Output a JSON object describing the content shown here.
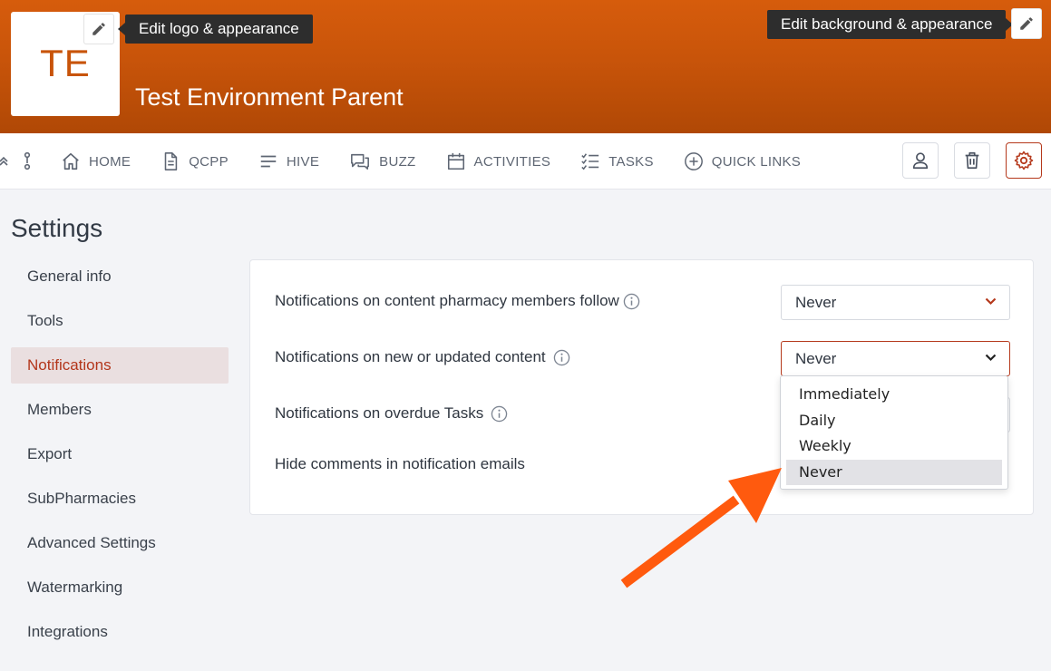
{
  "brand": {
    "logo_initials": "TE",
    "site_title": "Test Environment Parent",
    "edit_logo_tooltip": "Edit logo & appearance",
    "edit_background_tooltip": "Edit background & appearance",
    "accent_color": "#c8540a"
  },
  "nav": {
    "items": [
      {
        "label": "HOME",
        "icon": "home-icon"
      },
      {
        "label": "QCPP",
        "icon": "document-icon"
      },
      {
        "label": "HIVE",
        "icon": "lines-icon"
      },
      {
        "label": "BUZZ",
        "icon": "chat-icon"
      },
      {
        "label": "ACTIVITIES",
        "icon": "calendar-icon"
      },
      {
        "label": "TASKS",
        "icon": "checklist-icon"
      },
      {
        "label": "QUICK LINKS",
        "icon": "plus-circle-icon"
      }
    ],
    "right_buttons": [
      "user-icon",
      "trash-icon",
      "gear-icon"
    ]
  },
  "sidebar": {
    "title": "Settings",
    "items": [
      {
        "label": "General info"
      },
      {
        "label": "Tools"
      },
      {
        "label": "Notifications"
      },
      {
        "label": "Members"
      },
      {
        "label": "Export"
      },
      {
        "label": "SubPharmacies"
      },
      {
        "label": "Advanced Settings"
      },
      {
        "label": "Watermarking"
      },
      {
        "label": "Integrations"
      }
    ],
    "active": "Notifications"
  },
  "notifications": {
    "rows": [
      {
        "label": "Notifications on content pharmacy members follow",
        "value": "Never"
      },
      {
        "label": "Notifications on new or updated content",
        "value": "Never"
      },
      {
        "label": "Notifications on overdue Tasks",
        "value": ""
      },
      {
        "label": "Hide comments in notification emails"
      }
    ],
    "dropdown": {
      "options": [
        "Immediately",
        "Daily",
        "Weekly",
        "Never"
      ],
      "selected": "Never"
    }
  }
}
